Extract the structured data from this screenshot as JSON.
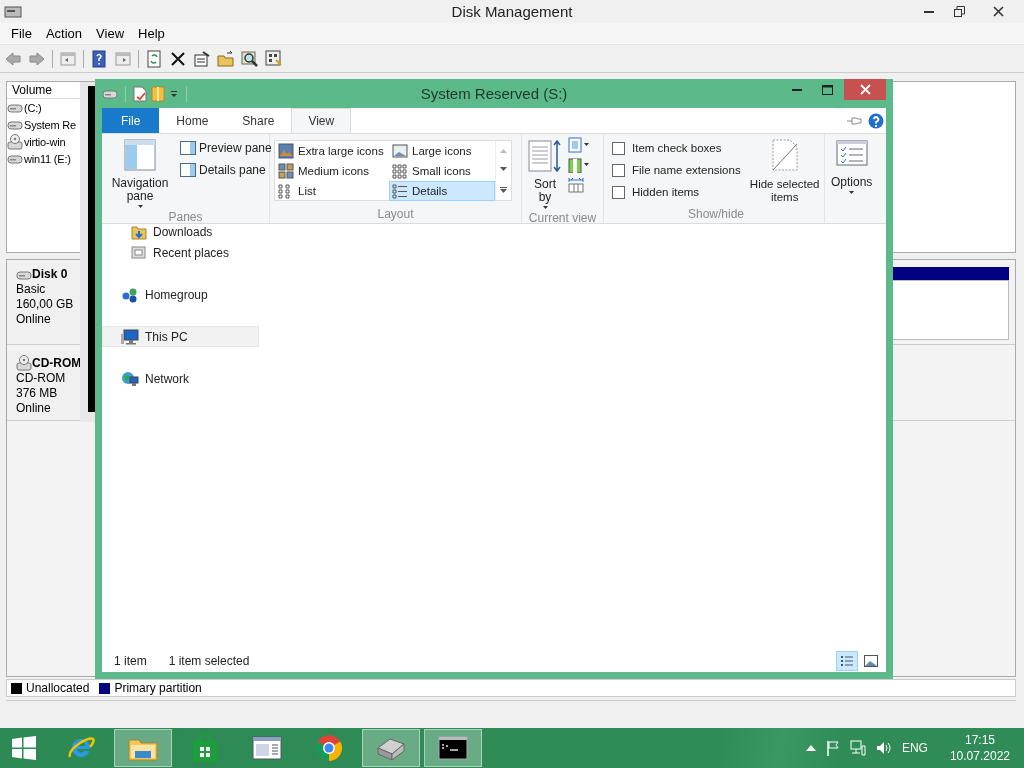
{
  "disk_management": {
    "title": "Disk Management",
    "menu": [
      "File",
      "Action",
      "View",
      "Help"
    ],
    "volume_list": {
      "column": "Volume",
      "rows": [
        {
          "label": "(C:)",
          "kind": "drive"
        },
        {
          "label": "System Re",
          "kind": "drive"
        },
        {
          "label": "virtio-win",
          "kind": "cd"
        },
        {
          "label": "win11 (E:)",
          "kind": "drive"
        }
      ]
    },
    "disks": [
      {
        "name": "Disk 0",
        "kind": "disk",
        "lines": [
          "Basic",
          "160,00 GB",
          "Online"
        ]
      },
      {
        "name": "CD-ROM",
        "kind": "cd",
        "lines": [
          "CD-ROM",
          "376 MB",
          "Online"
        ]
      }
    ],
    "legend": [
      {
        "label": "Unallocated",
        "color": "#000000"
      },
      {
        "label": "Primary partition",
        "color": "#000080"
      }
    ]
  },
  "explorer": {
    "title": "System Reserved (S:)",
    "tabs": [
      {
        "label": "File",
        "kind": "file",
        "selected": false
      },
      {
        "label": "Home",
        "kind": "tab",
        "selected": false
      },
      {
        "label": "Share",
        "kind": "tab",
        "selected": false
      },
      {
        "label": "View",
        "kind": "tab",
        "selected": true
      }
    ],
    "ribbon": {
      "panes": {
        "label": "Panes",
        "big": "Navigation pane",
        "items": [
          "Preview pane",
          "Details pane"
        ]
      },
      "layout": {
        "label": "Layout",
        "items": [
          {
            "label": "Extra large icons",
            "selected": false
          },
          {
            "label": "Large icons",
            "selected": false
          },
          {
            "label": "Medium icons",
            "selected": false
          },
          {
            "label": "Small icons",
            "selected": false
          },
          {
            "label": "List",
            "selected": false
          },
          {
            "label": "Details",
            "selected": true
          }
        ]
      },
      "current_view": {
        "label": "Current view",
        "sort": "Sort by"
      },
      "show_hide": {
        "label": "Show/hide",
        "checkboxes": [
          {
            "label": "Item check boxes",
            "checked": false
          },
          {
            "label": "File name extensions",
            "checked": false
          },
          {
            "label": "Hidden items",
            "checked": false
          }
        ],
        "hide": "Hide selected items"
      },
      "options": "Options"
    },
    "nav": [
      {
        "children": [
          {
            "label": "Downloads",
            "kind": "downloads",
            "selected": false
          },
          {
            "label": "Recent places",
            "kind": "recent",
            "selected": false
          }
        ]
      },
      {
        "label": "Homegroup",
        "kind": "homegroup",
        "selected": false
      },
      {
        "label": "This PC",
        "kind": "pc",
        "selected": true
      },
      {
        "label": "Network",
        "kind": "network",
        "selected": false
      }
    ],
    "status": [
      "1 item",
      "1 item selected"
    ],
    "view_buttons": [
      {
        "kind": "details",
        "selected": true
      },
      {
        "kind": "large",
        "selected": false
      }
    ]
  },
  "taskbar": {
    "apps": [
      {
        "kind": "start",
        "active": false
      },
      {
        "kind": "browser",
        "active": false
      },
      {
        "kind": "explorer",
        "active": true
      },
      {
        "kind": "store",
        "active": false
      },
      {
        "kind": "document",
        "active": false
      },
      {
        "kind": "chrome",
        "active": false
      },
      {
        "kind": "diskmgmt",
        "active": true
      },
      {
        "kind": "console",
        "active": true
      }
    ],
    "language": "ENG",
    "time": "17:15",
    "date": "10.07.2022"
  }
}
